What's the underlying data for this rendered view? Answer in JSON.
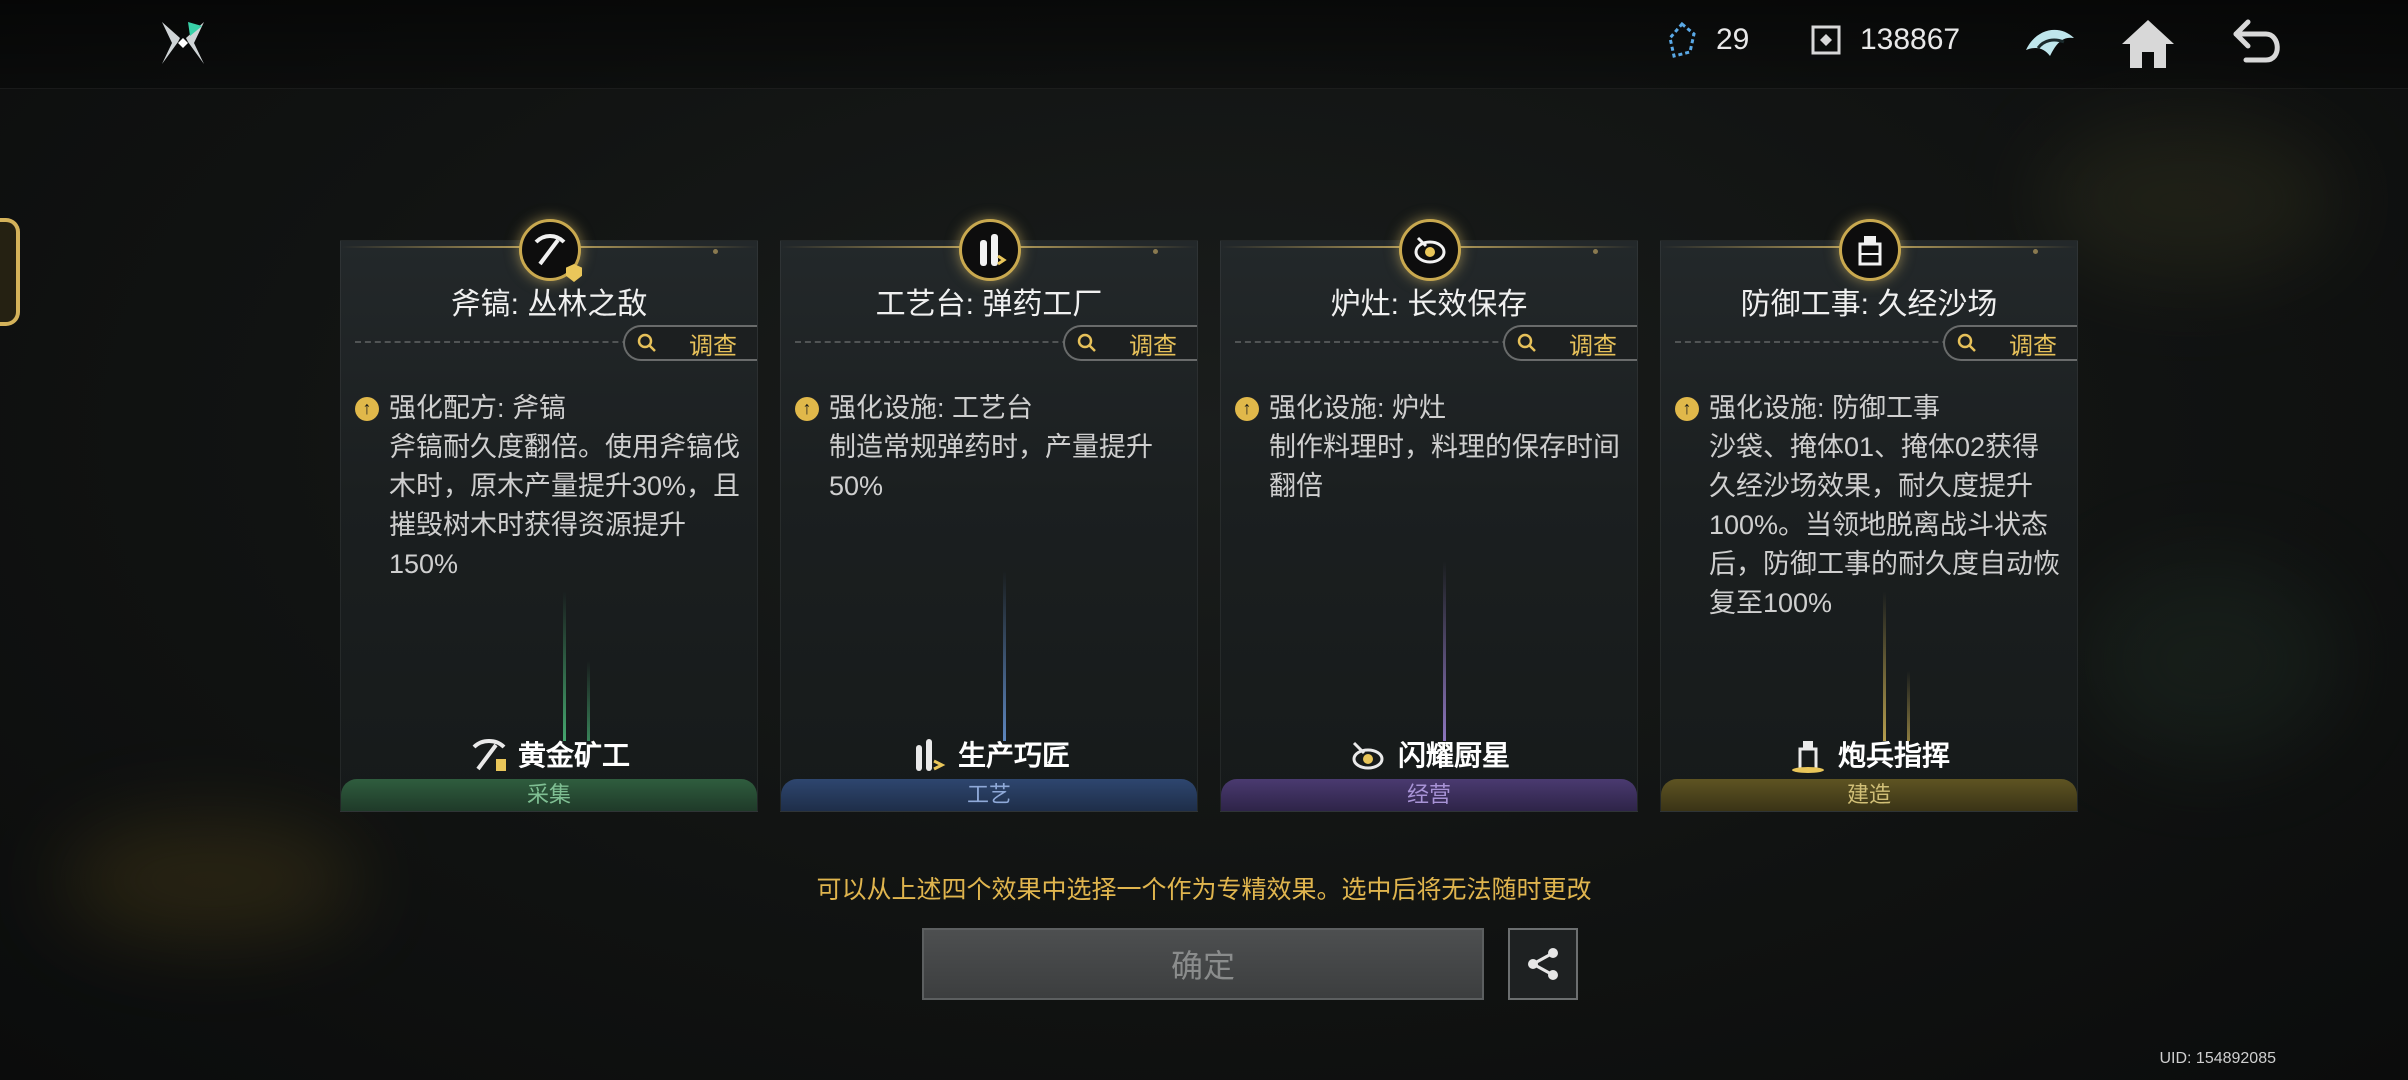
{
  "top_bar": {
    "resource_1": {
      "icon": "crystal-icon",
      "value": "29"
    },
    "resource_2": {
      "icon": "token-icon",
      "value": "138867"
    },
    "icons": [
      "faction-emblem-icon",
      "home-icon",
      "back-icon"
    ]
  },
  "cards": [
    {
      "title": "斧镐: 丛林之敌",
      "inspect_label": "调查",
      "effect_head": "强化配方: 斧镐",
      "effect_body": "斧镐耐久度翻倍。使用斧镐伐木时，原木产量提升30%，且摧毁树木时获得资源提升150%",
      "role": "黄金矿工",
      "category": "采集",
      "accent": "#3f8a5a"
    },
    {
      "title": "工艺台: 弹药工厂",
      "inspect_label": "调查",
      "effect_head": "强化设施: 工艺台",
      "effect_body": "制造常规弹药时，产量提升50%",
      "role": "生产巧匠",
      "category": "工艺",
      "accent": "#3f64a8"
    },
    {
      "title": "炉灶: 长效保存",
      "inspect_label": "调查",
      "effect_head": "强化设施: 炉灶",
      "effect_body": "制作料理时，料理的保存时间翻倍",
      "role": "闪耀厨星",
      "category": "经营",
      "accent": "#6a4fa8"
    },
    {
      "title": "防御工事: 久经沙场",
      "inspect_label": "调查",
      "effect_head": "强化设施: 防御工事",
      "effect_body": "沙袋、掩体01、掩体02获得久经沙场效果，耐久度提升100%。当领地脱离战斗状态后，防御工事的耐久度自动恢复至100%",
      "role": "炮兵指挥",
      "category": "建造",
      "accent": "#8a7a2e"
    }
  ],
  "hint": "可以从上述四个效果中选择一个作为专精效果。选中后将无法随时更改",
  "confirm_label": "确定",
  "uid": "UID: 154892085"
}
